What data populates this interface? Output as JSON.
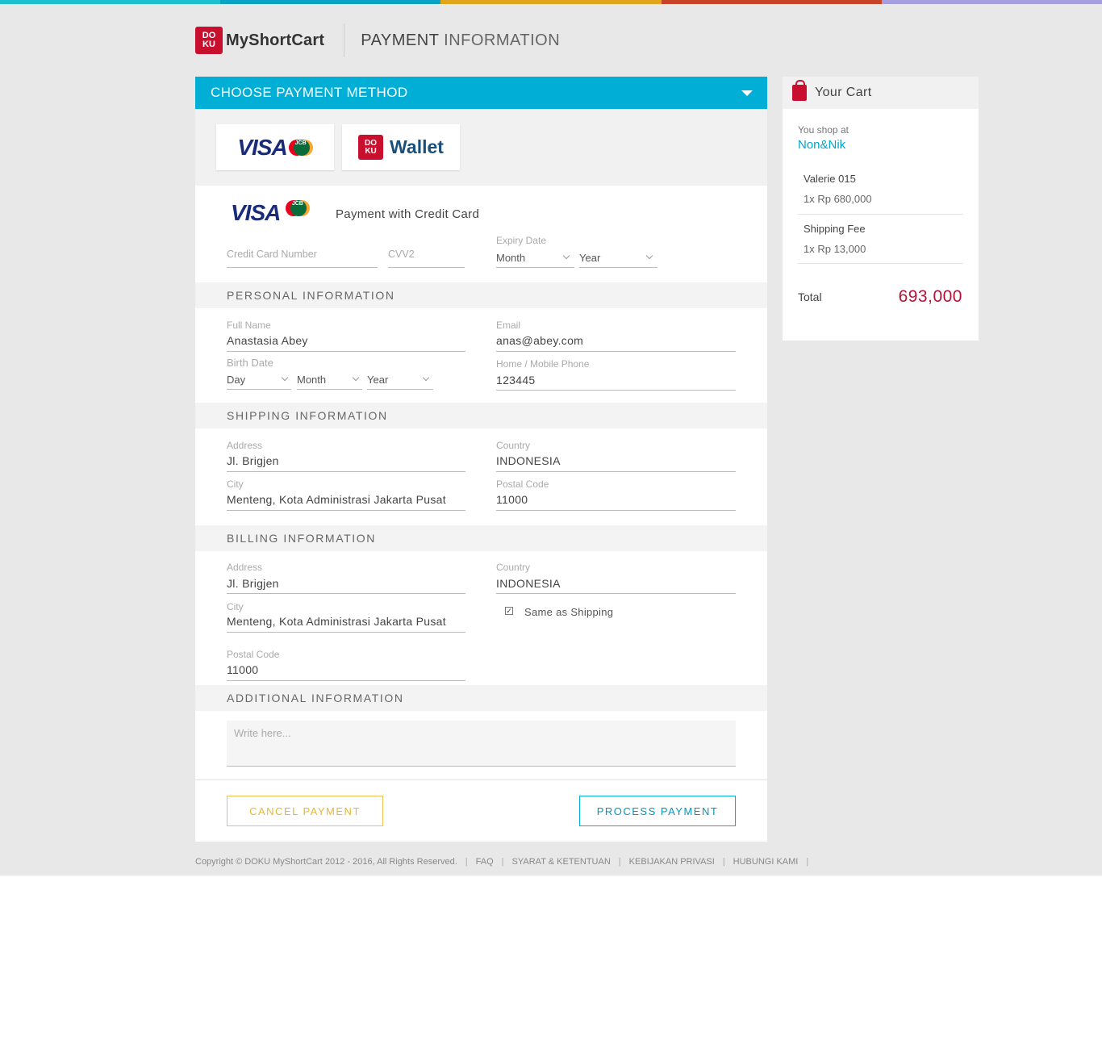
{
  "brand": {
    "logo_mark": "DO KU",
    "logo_text": "MyShortCart",
    "topbar_colors": [
      "#1cc1d1",
      "#0aa3c6",
      "#e1a51b",
      "#c7432a",
      "#a79ee0"
    ]
  },
  "header": {
    "title_bold": "PAYMENT",
    "title_light": "INFORMATION"
  },
  "payment_methods": {
    "bar_label": "CHOOSE PAYMENT METHOD",
    "visa_text": "VISA",
    "mastercard_label": "MasterCard",
    "jcb_label": "JCB",
    "wallet_mark": "DO KU",
    "wallet_label": "Wallet"
  },
  "credit_card": {
    "heading": "Payment with Credit Card",
    "card_number_placeholder": "Credit Card Number",
    "cvv_placeholder": "CVV2",
    "expiry_label": "Expiry Date",
    "expiry_month": "Month",
    "expiry_year": "Year"
  },
  "personal": {
    "section_title": "PERSONAL INFORMATION",
    "full_name_label": "Full Name",
    "full_name": "Anastasia Abey",
    "email_label": "Email",
    "email": "anas@abey.com",
    "birth_label": "Birth Date",
    "birth_day": "Day",
    "birth_month": "Month",
    "birth_year": "Year",
    "phone_label": "Home / Mobile Phone",
    "phone": "123445"
  },
  "shipping": {
    "section_title": "SHIPPING INFORMATION",
    "address_label": "Address",
    "address": "Jl. Brigjen",
    "country_label": "Country",
    "country": "INDONESIA",
    "city_label": "City",
    "city": "Menteng, Kota Administrasi Jakarta Pusat",
    "postal_label": "Postal Code",
    "postal": "11000"
  },
  "billing": {
    "section_title": "BILLING INFORMATION",
    "address_label": "Address",
    "address": "Jl. Brigjen",
    "country_label": "Country",
    "country": "INDONESIA",
    "city_label": "City",
    "city": "Menteng, Kota Administrasi Jakarta Pusat",
    "same_as_shipping_label": "Same as Shipping",
    "same_as_shipping_checked": true,
    "postal_label": "Postal Code",
    "postal": "11000"
  },
  "additional": {
    "section_title": "ADDITIONAL INFORMATION",
    "placeholder": "Write here..."
  },
  "actions": {
    "cancel_label": "CANCEL PAYMENT",
    "process_label": "PROCESS PAYMENT"
  },
  "cart": {
    "title": "Your Cart",
    "shop_at_label": "You shop at",
    "shop_name": "Non&Nik",
    "items": [
      {
        "name": "Valerie 015",
        "qty_price": "1x Rp 680,000"
      },
      {
        "name": "Shipping Fee",
        "qty_price": "1x Rp 13,000"
      }
    ],
    "total_label": "Total",
    "total_value": "693,000"
  },
  "footer": {
    "copyright": "Copyright © DOKU MyShortCart 2012 - 2016, All Rights Reserved.",
    "links": [
      "FAQ",
      "SYARAT & KETENTUAN",
      "KEBIJAKAN PRIVASI",
      "HUBUNGI KAMI"
    ]
  }
}
